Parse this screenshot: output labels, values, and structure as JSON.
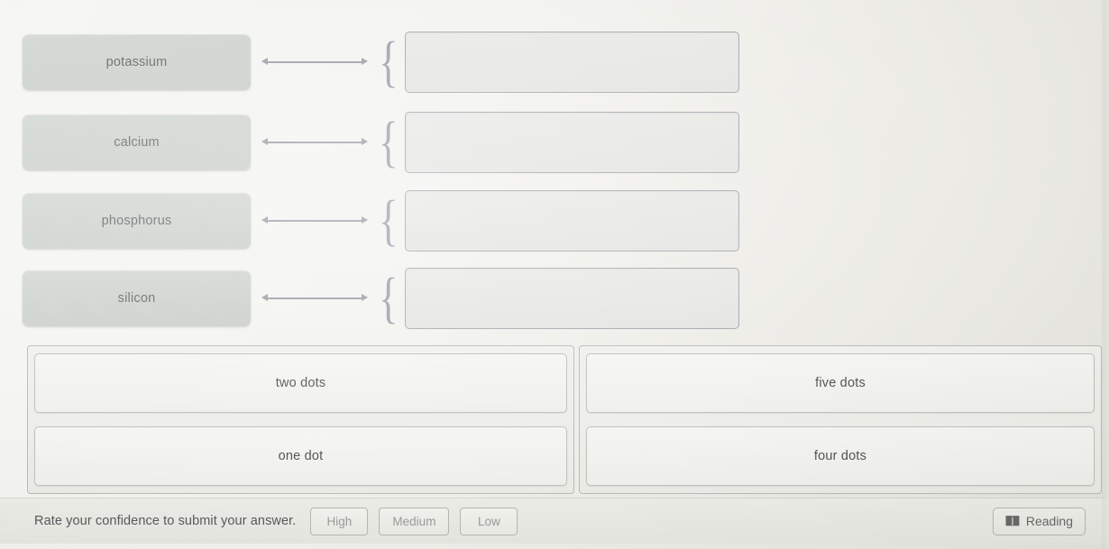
{
  "match_rows": [
    {
      "term": "potassium",
      "answer": "",
      "connector": "double-arrow",
      "brace": "{"
    },
    {
      "term": "calcium",
      "answer": "",
      "connector": "double-arrow",
      "brace": "{"
    },
    {
      "term": "phosphorus",
      "answer": "",
      "connector": "double-arrow",
      "brace": "{"
    },
    {
      "term": "silicon",
      "answer": "",
      "connector": "double-arrow",
      "brace": "{"
    }
  ],
  "answer_bank": {
    "left_column": [
      "two dots",
      "one dot"
    ],
    "right_column": [
      "five dots",
      "four dots"
    ]
  },
  "bottom_bar": {
    "confidence_prompt": "Rate your confidence to submit your answer.",
    "confidence_options": [
      "High",
      "Medium",
      "Low"
    ],
    "reading_label": "Reading",
    "reading_icon": "open-book-icon"
  },
  "colors": {
    "page_background": "#efefec",
    "term_tile": "#c6cbc6",
    "dropzone_border": "#9b9da4",
    "connector": "#8d8f99",
    "option_tile": "#f1f1ed",
    "bottom_bar": "#e8e8e2",
    "text_primary": "#44474a",
    "text_muted": "#8e918f"
  }
}
